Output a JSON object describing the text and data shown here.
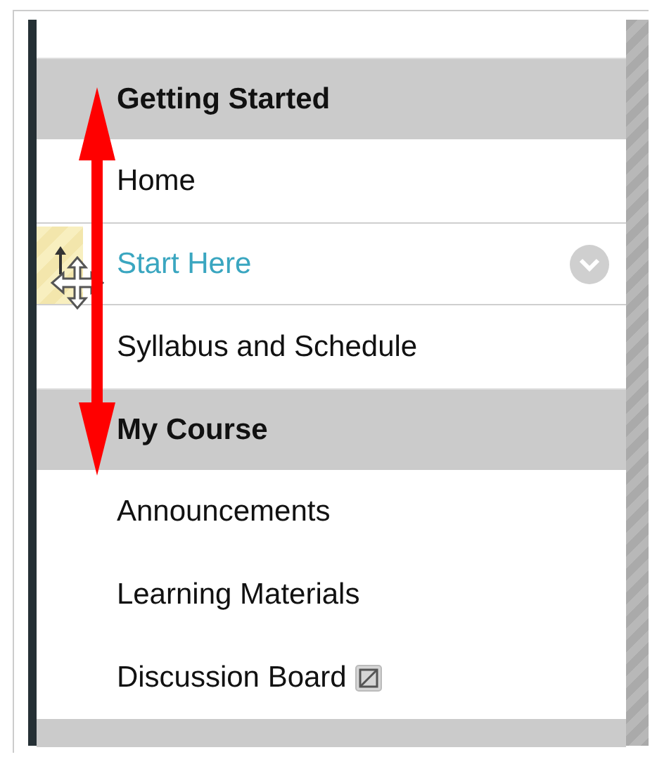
{
  "menu": {
    "items": [
      {
        "kind": "header",
        "label": "Getting Started"
      },
      {
        "kind": "link",
        "label": "Home",
        "selected": false,
        "unavailable": false
      },
      {
        "kind": "link",
        "label": "Start Here",
        "selected": true,
        "unavailable": false
      },
      {
        "kind": "link",
        "label": "Syllabus and Schedule",
        "selected": false,
        "unavailable": false
      },
      {
        "kind": "header",
        "label": "My Course"
      },
      {
        "kind": "link",
        "label": "Announcements",
        "selected": false,
        "unavailable": false
      },
      {
        "kind": "link",
        "label": "Learning Materials",
        "selected": false,
        "unavailable": false
      },
      {
        "kind": "link",
        "label": "Discussion Board",
        "selected": false,
        "unavailable": true
      }
    ]
  }
}
